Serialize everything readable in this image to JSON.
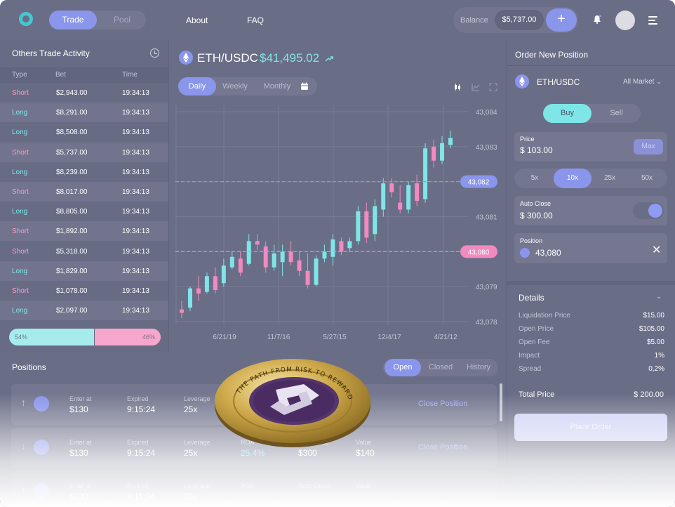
{
  "topbar": {
    "tabs": [
      "Trade",
      "Pool"
    ],
    "links": [
      "About",
      "FAQ"
    ],
    "balance_label": "Balance",
    "balance_value": "$5,737.00",
    "plus": "+"
  },
  "activity": {
    "title": "Others Trade Activity",
    "columns": [
      "Type",
      "Bet",
      "Time"
    ],
    "rows": [
      {
        "type": "Short",
        "bet": "$2,943.00",
        "time": "19:34:13"
      },
      {
        "type": "Long",
        "bet": "$8,291.00",
        "time": "19:34:13"
      },
      {
        "type": "Long",
        "bet": "$8,508.00",
        "time": "19:34:13"
      },
      {
        "type": "Short",
        "bet": "$5,737.00",
        "time": "19:34:13"
      },
      {
        "type": "Long",
        "bet": "$8,239.00",
        "time": "19:34:13"
      },
      {
        "type": "Short",
        "bet": "$8,017.00",
        "time": "19:34:13"
      },
      {
        "type": "Long",
        "bet": "$8,805.00",
        "time": "19:34:13"
      },
      {
        "type": "Short",
        "bet": "$1,892.00",
        "time": "19:34:13"
      },
      {
        "type": "Short",
        "bet": "$5,318.00",
        "time": "19:34:13"
      },
      {
        "type": "Long",
        "bet": "$1,829.00",
        "time": "19:34:13"
      },
      {
        "type": "Short",
        "bet": "$1,078.00",
        "time": "19:34:13"
      },
      {
        "type": "Long",
        "bet": "$2,097.00",
        "time": "19:34:13"
      }
    ],
    "long_pct_label": "54%",
    "short_pct_label": "46%",
    "long_fraction": 0.56
  },
  "chart_header": {
    "pair": "ETH/USDC",
    "price": "$41,495.02",
    "tabs": [
      "Daily",
      "Weekly",
      "Monthly"
    ]
  },
  "chart_data": {
    "type": "candlestick",
    "y_ticks": [
      "43,084",
      "43,083",
      "43,082",
      "43,081",
      "43,080",
      "43,079",
      "43,078"
    ],
    "x_ticks": [
      "6/21/19",
      "11/7/16",
      "5/27/15",
      "12/4/17",
      "4/21/12"
    ],
    "markers": [
      {
        "label": "43,082",
        "value": 43082.0,
        "color": "#8a96ec"
      },
      {
        "label": "43,080",
        "value": 43080.0,
        "color": "#f28ac0"
      }
    ],
    "ylim": [
      43077.9,
      43084.2
    ],
    "candles": [
      {
        "o": 43078.35,
        "h": 43078.6,
        "c": 43078.25,
        "l": 43078.1
      },
      {
        "o": 43078.4,
        "h": 43079.0,
        "c": 43078.95,
        "l": 43078.3
      },
      {
        "o": 43078.95,
        "h": 43079.3,
        "c": 43078.8,
        "l": 43078.6
      },
      {
        "o": 43078.85,
        "h": 43079.4,
        "c": 43079.3,
        "l": 43078.8
      },
      {
        "o": 43079.3,
        "h": 43079.55,
        "c": 43078.9,
        "l": 43078.8
      },
      {
        "o": 43079.1,
        "h": 43079.8,
        "c": 43079.6,
        "l": 43079.0
      },
      {
        "o": 43079.55,
        "h": 43080.0,
        "c": 43079.85,
        "l": 43079.5
      },
      {
        "o": 43079.8,
        "h": 43080.0,
        "c": 43079.4,
        "l": 43079.3
      },
      {
        "o": 43079.65,
        "h": 43080.5,
        "c": 43080.3,
        "l": 43079.6
      },
      {
        "o": 43080.3,
        "h": 43080.5,
        "c": 43080.2,
        "l": 43080.05
      },
      {
        "o": 43080.15,
        "h": 43080.3,
        "c": 43079.55,
        "l": 43079.4
      },
      {
        "o": 43079.55,
        "h": 43080.2,
        "c": 43079.95,
        "l": 43079.45
      },
      {
        "o": 43079.7,
        "h": 43080.2,
        "c": 43080.0,
        "l": 43079.3
      },
      {
        "o": 43080.0,
        "h": 43080.3,
        "c": 43079.7,
        "l": 43079.6
      },
      {
        "o": 43079.75,
        "h": 43080.0,
        "c": 43079.45,
        "l": 43079.3
      },
      {
        "o": 43079.45,
        "h": 43079.95,
        "c": 43079.05,
        "l": 43078.95
      },
      {
        "o": 43079.05,
        "h": 43079.9,
        "c": 43079.8,
        "l": 43079.0
      },
      {
        "o": 43079.8,
        "h": 43080.2,
        "c": 43080.0,
        "l": 43079.7
      },
      {
        "o": 43079.85,
        "h": 43080.5,
        "c": 43080.35,
        "l": 43079.6
      },
      {
        "o": 43080.3,
        "h": 43080.4,
        "c": 43080.0,
        "l": 43079.9
      },
      {
        "o": 43080.1,
        "h": 43080.4,
        "c": 43080.3,
        "l": 43080.0
      },
      {
        "o": 43080.3,
        "h": 43081.3,
        "c": 43081.15,
        "l": 43080.2
      },
      {
        "o": 43081.15,
        "h": 43081.4,
        "c": 43080.4,
        "l": 43080.25
      },
      {
        "o": 43080.5,
        "h": 43081.5,
        "c": 43081.3,
        "l": 43080.3
      },
      {
        "o": 43081.2,
        "h": 43082.1,
        "c": 43081.95,
        "l": 43081.0
      },
      {
        "o": 43081.95,
        "h": 43082.1,
        "c": 43081.7,
        "l": 43081.55
      },
      {
        "o": 43081.4,
        "h": 43081.9,
        "c": 43081.2,
        "l": 43081.1
      },
      {
        "o": 43081.2,
        "h": 43082.0,
        "c": 43081.9,
        "l": 43081.1
      },
      {
        "o": 43081.95,
        "h": 43082.2,
        "c": 43081.45,
        "l": 43081.3
      },
      {
        "o": 43081.5,
        "h": 43083.1,
        "c": 43082.95,
        "l": 43081.4
      },
      {
        "o": 43083.0,
        "h": 43083.2,
        "c": 43082.6,
        "l": 43082.4
      },
      {
        "o": 43082.6,
        "h": 43083.3,
        "c": 43083.1,
        "l": 43082.5
      },
      {
        "o": 43083.05,
        "h": 43083.45,
        "c": 43083.25,
        "l": 43082.95
      }
    ]
  },
  "order": {
    "title": "Order New Position",
    "pair": "ETH/USDC",
    "market": "All Market",
    "buy": "Buy",
    "sell": "Sell",
    "price_label": "Price",
    "price_value": "$ 103.00",
    "max": "Max",
    "leverage": [
      "5x",
      "10x",
      "25x",
      "50x"
    ],
    "auto_close_label": "Auto Close",
    "auto_close_value": "$ 300.00",
    "position_label": "Position",
    "position_value": "43,080",
    "details_title": "Details",
    "details": [
      {
        "k": "Liquidation Price",
        "v": "$15.00"
      },
      {
        "k": "Open Price",
        "v": "$105.00"
      },
      {
        "k": "Open Fee",
        "v": "$5.00"
      },
      {
        "k": "Impact",
        "v": "1%"
      },
      {
        "k": "Spread",
        "v": "0,2%"
      }
    ],
    "total_label": "Total Price",
    "total_value": "$ 200.00",
    "place": "Place Order"
  },
  "positions": {
    "title": "Positions",
    "tabs": [
      "Open",
      "Closed",
      "History"
    ],
    "rows": [
      {
        "dir": "↑",
        "enter_label": "Enter at",
        "enter": "$130",
        "exp_label": "Expired",
        "exp": "9:15:24",
        "lev_label": "Leverage",
        "lev": "25x",
        "roa_label": "",
        "roa": "",
        "ac_label": "",
        "ac": "",
        "val_label": "",
        "val": "0",
        "btn": "Close Position"
      },
      {
        "dir": "↓",
        "enter_label": "Enter at",
        "enter": "$130",
        "exp_label": "Expired",
        "exp": "9:15:24",
        "lev_label": "Leverage",
        "lev": "25x",
        "roa_label": "ROA",
        "roa": "25.4%",
        "ac_label": "Auto Close",
        "ac": "$300",
        "val_label": "Value",
        "val": "$140",
        "btn": "Close Position"
      },
      {
        "dir": "↑",
        "enter_label": "Enter at",
        "enter": "$130",
        "exp_label": "Expired",
        "exp": "9:15:24",
        "lev_label": "Leverage",
        "lev": "25x",
        "roa_label": "ROA",
        "roa": "",
        "ac_label": "Auto Close",
        "ac": "",
        "val_label": "Value",
        "val": "",
        "btn": ""
      }
    ]
  },
  "coin_text": "THE PATH FROM RISK TO REWARD",
  "colors": {
    "accent": "#8a96ec",
    "long": "#7ee6e6",
    "short": "#f28ac0",
    "bg": "#686b84"
  }
}
